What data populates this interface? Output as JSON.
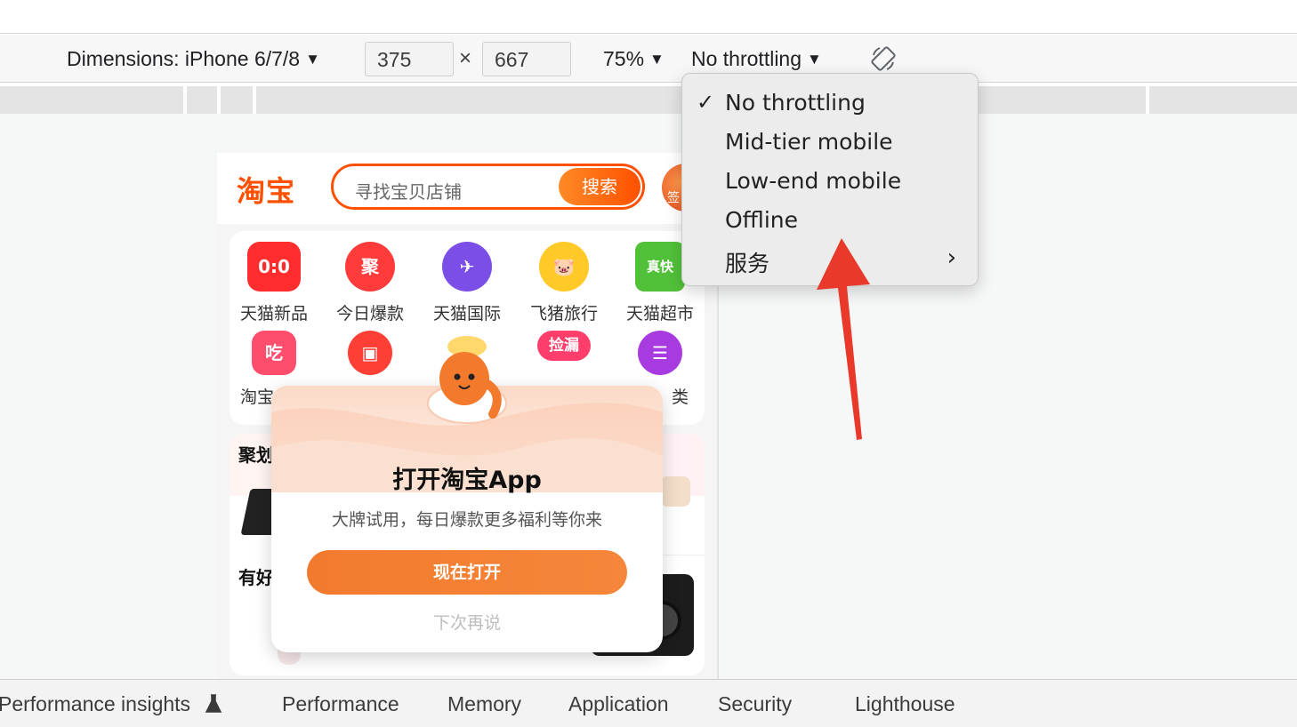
{
  "toolbar": {
    "dimensions_label": "Dimensions: iPhone 6/7/8",
    "width_value": "375",
    "times": "×",
    "height_value": "667",
    "zoom_label": "75%",
    "throttle_label": "No throttling",
    "caret": "▼"
  },
  "throttle_menu": {
    "items": [
      {
        "label": "No throttling",
        "checked": "✓"
      },
      {
        "label": "Mid-tier mobile",
        "checked": ""
      },
      {
        "label": "Low-end mobile",
        "checked": ""
      },
      {
        "label": "Offline",
        "checked": ""
      },
      {
        "label": "服务",
        "chevron": "›"
      }
    ]
  },
  "taobao": {
    "logo": "淘宝",
    "search_placeholder": "寻找宝贝店铺",
    "search_button": "搜索",
    "sign_badge": "签",
    "categories": [
      {
        "label": "天猫新品",
        "icon": "0:0",
        "color": "#ff2d2d"
      },
      {
        "label": "今日爆款",
        "icon": "聚",
        "color": "#ff3b3b"
      },
      {
        "label": "天猫国际",
        "icon": "✈",
        "color": "#7b4ee8"
      },
      {
        "label": "飞猪旅行",
        "icon": "🐷",
        "color": "#ffc928"
      },
      {
        "label": "天猫超市",
        "icon": "真快",
        "color": "#52c13a"
      },
      {
        "label": "淘宝",
        "icon": "吃",
        "color": "#ff4d6d"
      },
      {
        "label": "",
        "icon": "▣",
        "color": "#ff3e36"
      },
      {
        "label": "",
        "icon": "●",
        "color": "#ffb328"
      },
      {
        "label": "",
        "icon": "捡漏",
        "color": "#ff3e6c"
      },
      {
        "label": "类",
        "icon": "☰",
        "color": "#a83be0"
      }
    ],
    "promo_title_1": "聚划",
    "promo_title_2": "有好"
  },
  "popup": {
    "title": "打开淘宝App",
    "subtitle": "大牌试用，每日爆款更多福利等你来",
    "open_button": "现在打开",
    "later_link": "下次再说"
  },
  "bottom_tabs": [
    "Performance insights",
    "Performance",
    "Memory",
    "Application",
    "Security",
    "Lighthouse"
  ],
  "colors": {
    "taobao_orange": "#ff5000",
    "annotation_arrow": "#e8392a"
  }
}
